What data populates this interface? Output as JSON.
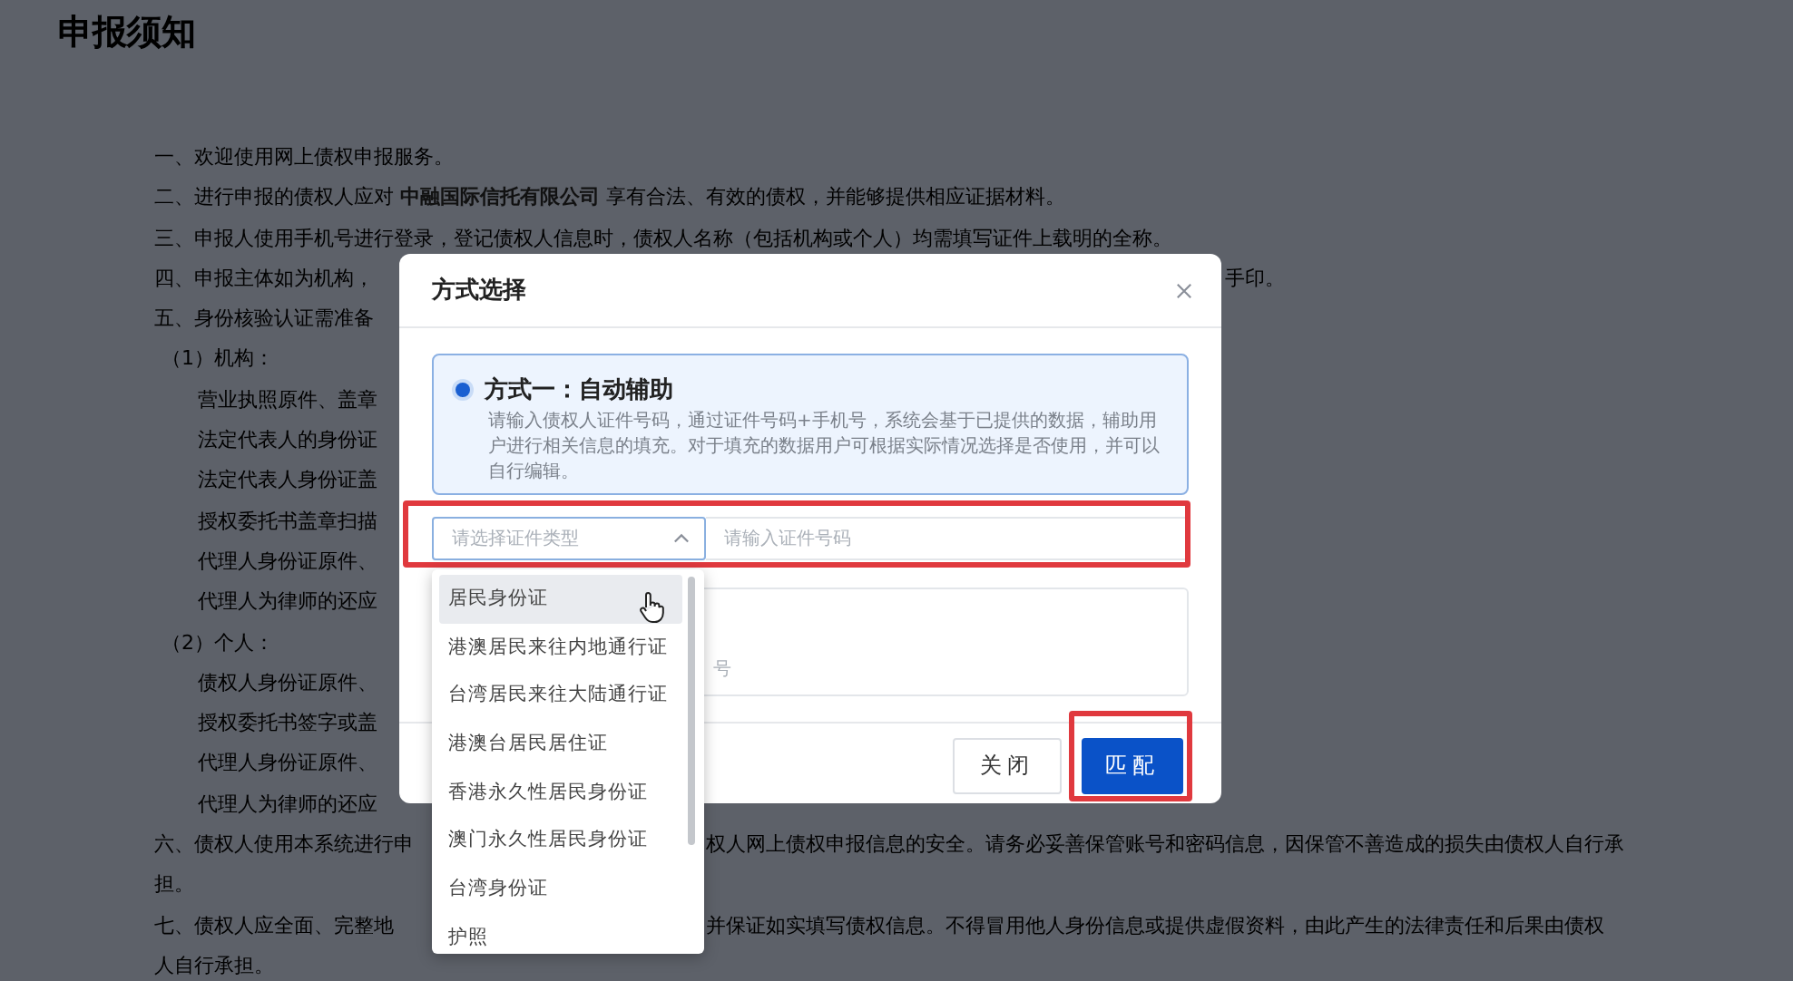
{
  "page": {
    "title": "申报须知",
    "notice": [
      {
        "kind": "item",
        "text": "一、欢迎使用网上债权申报服务。"
      },
      {
        "kind": "item",
        "text": "二、进行申报的债权人应对 **中融国际信托有限公司** 享有合法、有效的债权，并能够提供相应证据材料。"
      },
      {
        "kind": "item",
        "text": "三、申报人使用手机号进行登录，登记债权人信息时，债权人名称（包括机构或个人）均需填写证件上载明的全称。"
      },
      {
        "kind": "item",
        "text": "四、申报主体如为机构，",
        "tail": {
          "text": "手印。",
          "after_menu": false
        }
      },
      {
        "kind": "item",
        "text": "五、身份核验认证需准备"
      },
      {
        "kind": "sub-heading",
        "text": "（1）机构："
      },
      {
        "kind": "sub-item",
        "text": "营业执照原件、盖章"
      },
      {
        "kind": "sub-item",
        "text": "法定代表人的身份证"
      },
      {
        "kind": "sub-item",
        "text": "法定代表人身份证盖"
      },
      {
        "kind": "sub-item",
        "text": "授权委托书盖章扫描"
      },
      {
        "kind": "sub-item",
        "text": "代理人身份证原件、"
      },
      {
        "kind": "sub-item",
        "text": "代理人为律师的还应"
      },
      {
        "kind": "sub-heading",
        "text": "（2）个人："
      },
      {
        "kind": "sub-item",
        "text": "债权人身份证原件、"
      },
      {
        "kind": "sub-item",
        "text": "授权委托书签字或盖"
      },
      {
        "kind": "sub-item",
        "text": "代理人身份证原件、"
      },
      {
        "kind": "sub-item",
        "text": "代理人为律师的还应"
      },
      {
        "kind": "item",
        "text": "六、债权人使用本系统进行申",
        "tail": {
          "text": "权人网上债权申报信息的安全。请务必妥善保管账号和密码信息，因保管不善造成的损失由债权人自行承",
          "after_menu": true
        }
      },
      {
        "kind": "item",
        "text": "担。"
      },
      {
        "kind": "item",
        "text": "七、债权人应全面、完整地",
        "tail": {
          "text": "并保证如实填写债权信息。不得冒用他人身份信息或提供虚假资料，由此产生的法律责任和后果由债权",
          "after_menu": true
        }
      },
      {
        "kind": "item",
        "text": "人自行承担。"
      }
    ]
  },
  "dialog": {
    "title": "方式选择",
    "option": {
      "title": "方式一：自动辅助",
      "description": "请输入债权人证件号码，通过证件号码+手机号，系统会基于已提供的数据，辅助用户进行相关信息的填充。对于填充的数据用户可根据实际情况选择是否使用，并可以自行编辑。",
      "selected": true
    },
    "id_type": {
      "placeholder": "请选择证件类型",
      "expanded": true
    },
    "id_number": {
      "placeholder": "请输入证件号码"
    },
    "phone_field": {
      "text": "号"
    },
    "buttons": [
      {
        "label": "关闭",
        "kind": "default"
      },
      {
        "label": "匹配",
        "kind": "primary"
      }
    ],
    "id_type_menu": [
      {
        "label": "居民身份证",
        "highlighted": true
      },
      {
        "label": "港澳居民来往内地通行证",
        "highlighted": false
      },
      {
        "label": "台湾居民来往大陆通行证",
        "highlighted": false
      },
      {
        "label": "港澳台居民居住证",
        "highlighted": false
      },
      {
        "label": "香港永久性居民身份证",
        "highlighted": false
      },
      {
        "label": "澳门永久性居民身份证",
        "highlighted": false
      },
      {
        "label": "台湾身份证",
        "highlighted": false
      },
      {
        "label": "护照",
        "highlighted": false
      }
    ]
  }
}
